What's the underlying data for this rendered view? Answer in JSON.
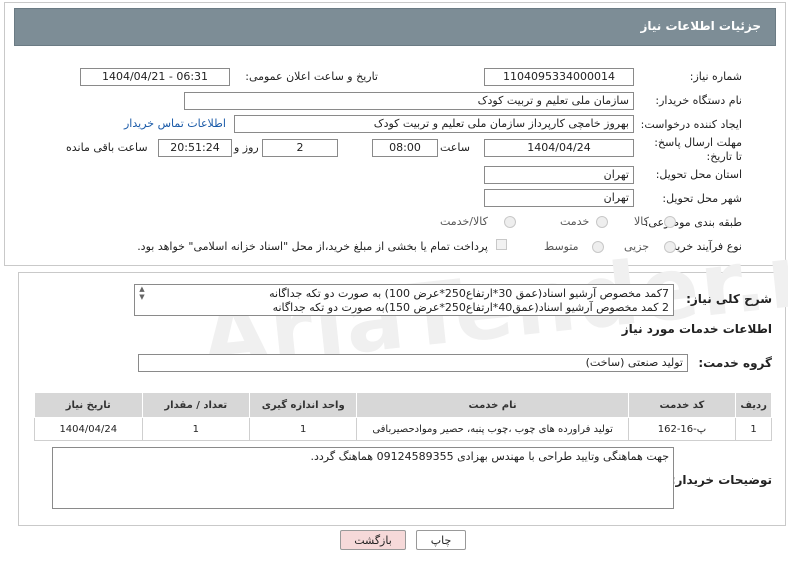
{
  "header": {
    "title": "جزئیات اطلاعات نیاز"
  },
  "fields": {
    "need_number_label": "شماره نیاز:",
    "need_number": "1104095334000014",
    "announce_label": "تاریخ و ساعت اعلان عمومی:",
    "announce_value": "1404/04/21 - 06:31",
    "buyer_label": "نام دستگاه خریدار:",
    "buyer_value": "سازمان ملی تعلیم و تربیت کودک",
    "creator_label": "ایجاد کننده درخواست:",
    "creator_value": "بهروز خامچی کارپرداز سازمان ملی تعلیم و تربیت کودک",
    "contact_link": "اطلاعات تماس خریدار",
    "deadline_label": "مهلت ارسال پاسخ: تا تاریخ:",
    "deadline_date": "1404/04/24",
    "time_label": "ساعت",
    "deadline_time": "08:00",
    "days_value": "2",
    "days_label": "روز و",
    "remaining_time": "20:51:24",
    "remaining_label": "ساعت باقی مانده",
    "province_label": "استان محل تحویل:",
    "province_value": "تهران",
    "city_label": "شهر محل تحویل:",
    "city_value": "تهران",
    "category_label": "طبقه بندی موضوعی:",
    "category_options": [
      "کالا",
      "خدمت",
      "کالا/خدمت"
    ],
    "process_label": "نوع فرآیند خرید :",
    "process_options": [
      "جزیی",
      "متوسط"
    ],
    "payment_note": "پرداخت تمام یا بخشی از مبلغ خرید،از محل \"اسناد خزانه اسلامی\" خواهد بود."
  },
  "description": {
    "label": "شرح کلی نیاز:",
    "line1": "7کمد مخصوص آرشیو اسناد(عمق 30*ارتفاع250*عرض 100) به صورت دو تکه جداگانه",
    "line2": "2 کمد مخصوص آرشیو اسناد(عمق40*ارتفاع250*عرض 150)به صورت دو تکه جداگانه"
  },
  "services": {
    "section_title": "اطلاعات خدمات مورد نیاز",
    "group_label": "گروه خدمت:",
    "group_value": "تولید صنعتی (ساخت)",
    "columns": [
      "ردیف",
      "کد خدمت",
      "نام خدمت",
      "واحد اندازه گیری",
      "تعداد / مقدار",
      "تاریخ نیاز"
    ],
    "rows": [
      {
        "row": "1",
        "code": "پ-16-162",
        "name": "تولید فراورده های چوب ،چوب پنبه، حصیر وموادحصیربافی",
        "unit": "1",
        "qty": "1",
        "date": "1404/04/24"
      }
    ]
  },
  "buyer_notes": {
    "label": "توضیحات خریدار:",
    "text": "جهت هماهنگی وتایید طراحی با مهندس بهزادی 09124589355 هماهنگ گردد."
  },
  "buttons": {
    "print": "چاپ",
    "back": "بازگشت"
  },
  "colors": {
    "header_bg": "#7d8d96",
    "link": "#1a5aa8",
    "back_btn": "#f6d9d9"
  }
}
